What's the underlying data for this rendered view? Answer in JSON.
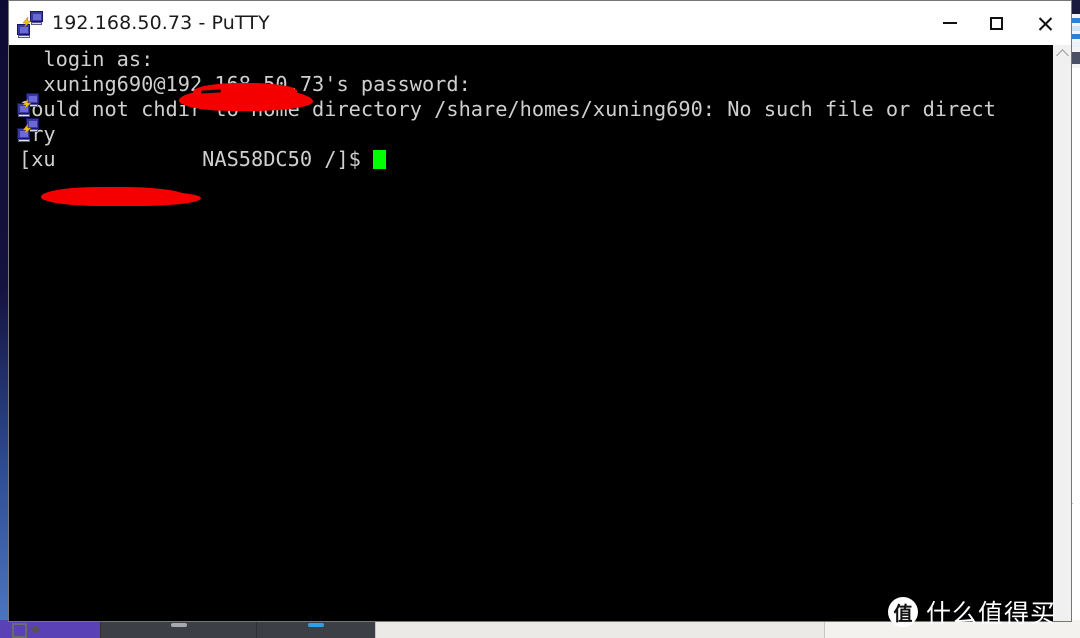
{
  "window": {
    "title": "192.168.50.73 - PuTTY",
    "icon": "putty-session-icon",
    "controls": {
      "minimize": "—",
      "maximize": "□",
      "close": "✕"
    }
  },
  "terminal": {
    "background_color": "#000000",
    "foreground_color": "#cfcfcf",
    "cursor_color": "#00ff00",
    "lines": [
      "  login as: ",
      "  xuning690@192.168.50.73's password:",
      "Could not chdir to home directory /share/homes/xuning690: No such file or direct",
      "ory",
      "[xu            NAS58DC50 /]$ "
    ],
    "redactions": [
      {
        "line": 0,
        "note": "red scribble over username"
      },
      {
        "line": 4,
        "note": "red scribble over user@host in prompt"
      }
    ],
    "prompt_visible_text": "NAS58DC50 /]$",
    "scrollbar": {
      "up_arrow": "chevron-up"
    }
  },
  "watermark": {
    "badge": "值",
    "text": "什么值得买"
  },
  "taskbar": {
    "segments": [
      "purple-app",
      "window-1",
      "window-2",
      "light-area",
      "light-area-2"
    ]
  }
}
